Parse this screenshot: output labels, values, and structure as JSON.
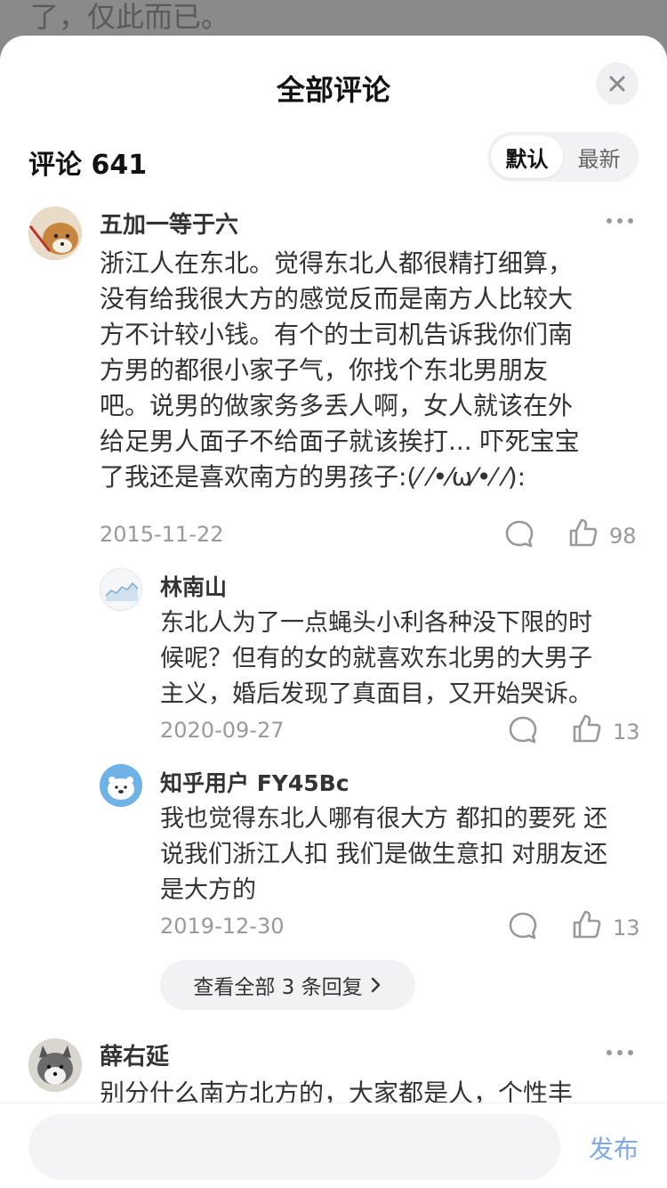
{
  "background": {
    "text": "了，仅此而已。"
  },
  "sheet": {
    "title": "全部评论"
  },
  "header": {
    "count_label": "评论 641",
    "sort": {
      "default": "默认",
      "latest": "最新"
    }
  },
  "comments": [
    {
      "author": "五加一等于六",
      "lines": [
        "浙江人在东北。觉得东北人都很精打细算，",
        "没有给我很大方的感觉反而是南方人比较大",
        "方不计较小钱。有个的士司机告诉我你们南",
        "方男的都很小家子气，你找个东北男朋友",
        "吧。说男的做家务多丢人啊，女人就该在外",
        "给足男人面子不给面子就该挨打...   吓死宝宝",
        "了我还是喜欢南方的男孩子:(⁄ ⁄•⁄ω⁄•⁄ ⁄):"
      ],
      "date": "2015-11-22",
      "likes": "98"
    },
    {
      "author": "林南山",
      "lines": [
        "东北人为了一点蝇头小利各种没下限的时",
        "候呢？但有的女的就喜欢东北男的大男子",
        "主义，婚后发现了真面目，又开始哭诉。"
      ],
      "date": "2020-09-27",
      "likes": "13"
    },
    {
      "author": "知乎用户 FY45Bc",
      "lines": [
        "我也觉得东北人哪有很大方 都扣的要死 还",
        "说我们浙江人扣  我们是做生意扣 对朋友还",
        "是大方的"
      ],
      "date": "2019-12-30",
      "likes": "13"
    },
    {
      "author": "薛右延",
      "lines": [
        "别分什么南方北方的，大家都是人，个性丰"
      ]
    }
  ],
  "view_all": {
    "label": "查看全部 3 条回复"
  },
  "composer": {
    "publish_label": "发布"
  },
  "colors": {
    "accent": "#7fa9e8",
    "muted": "#999999"
  },
  "icons": [
    "close-icon",
    "more-icon",
    "comment-icon",
    "like-icon",
    "chevron-right-icon"
  ]
}
